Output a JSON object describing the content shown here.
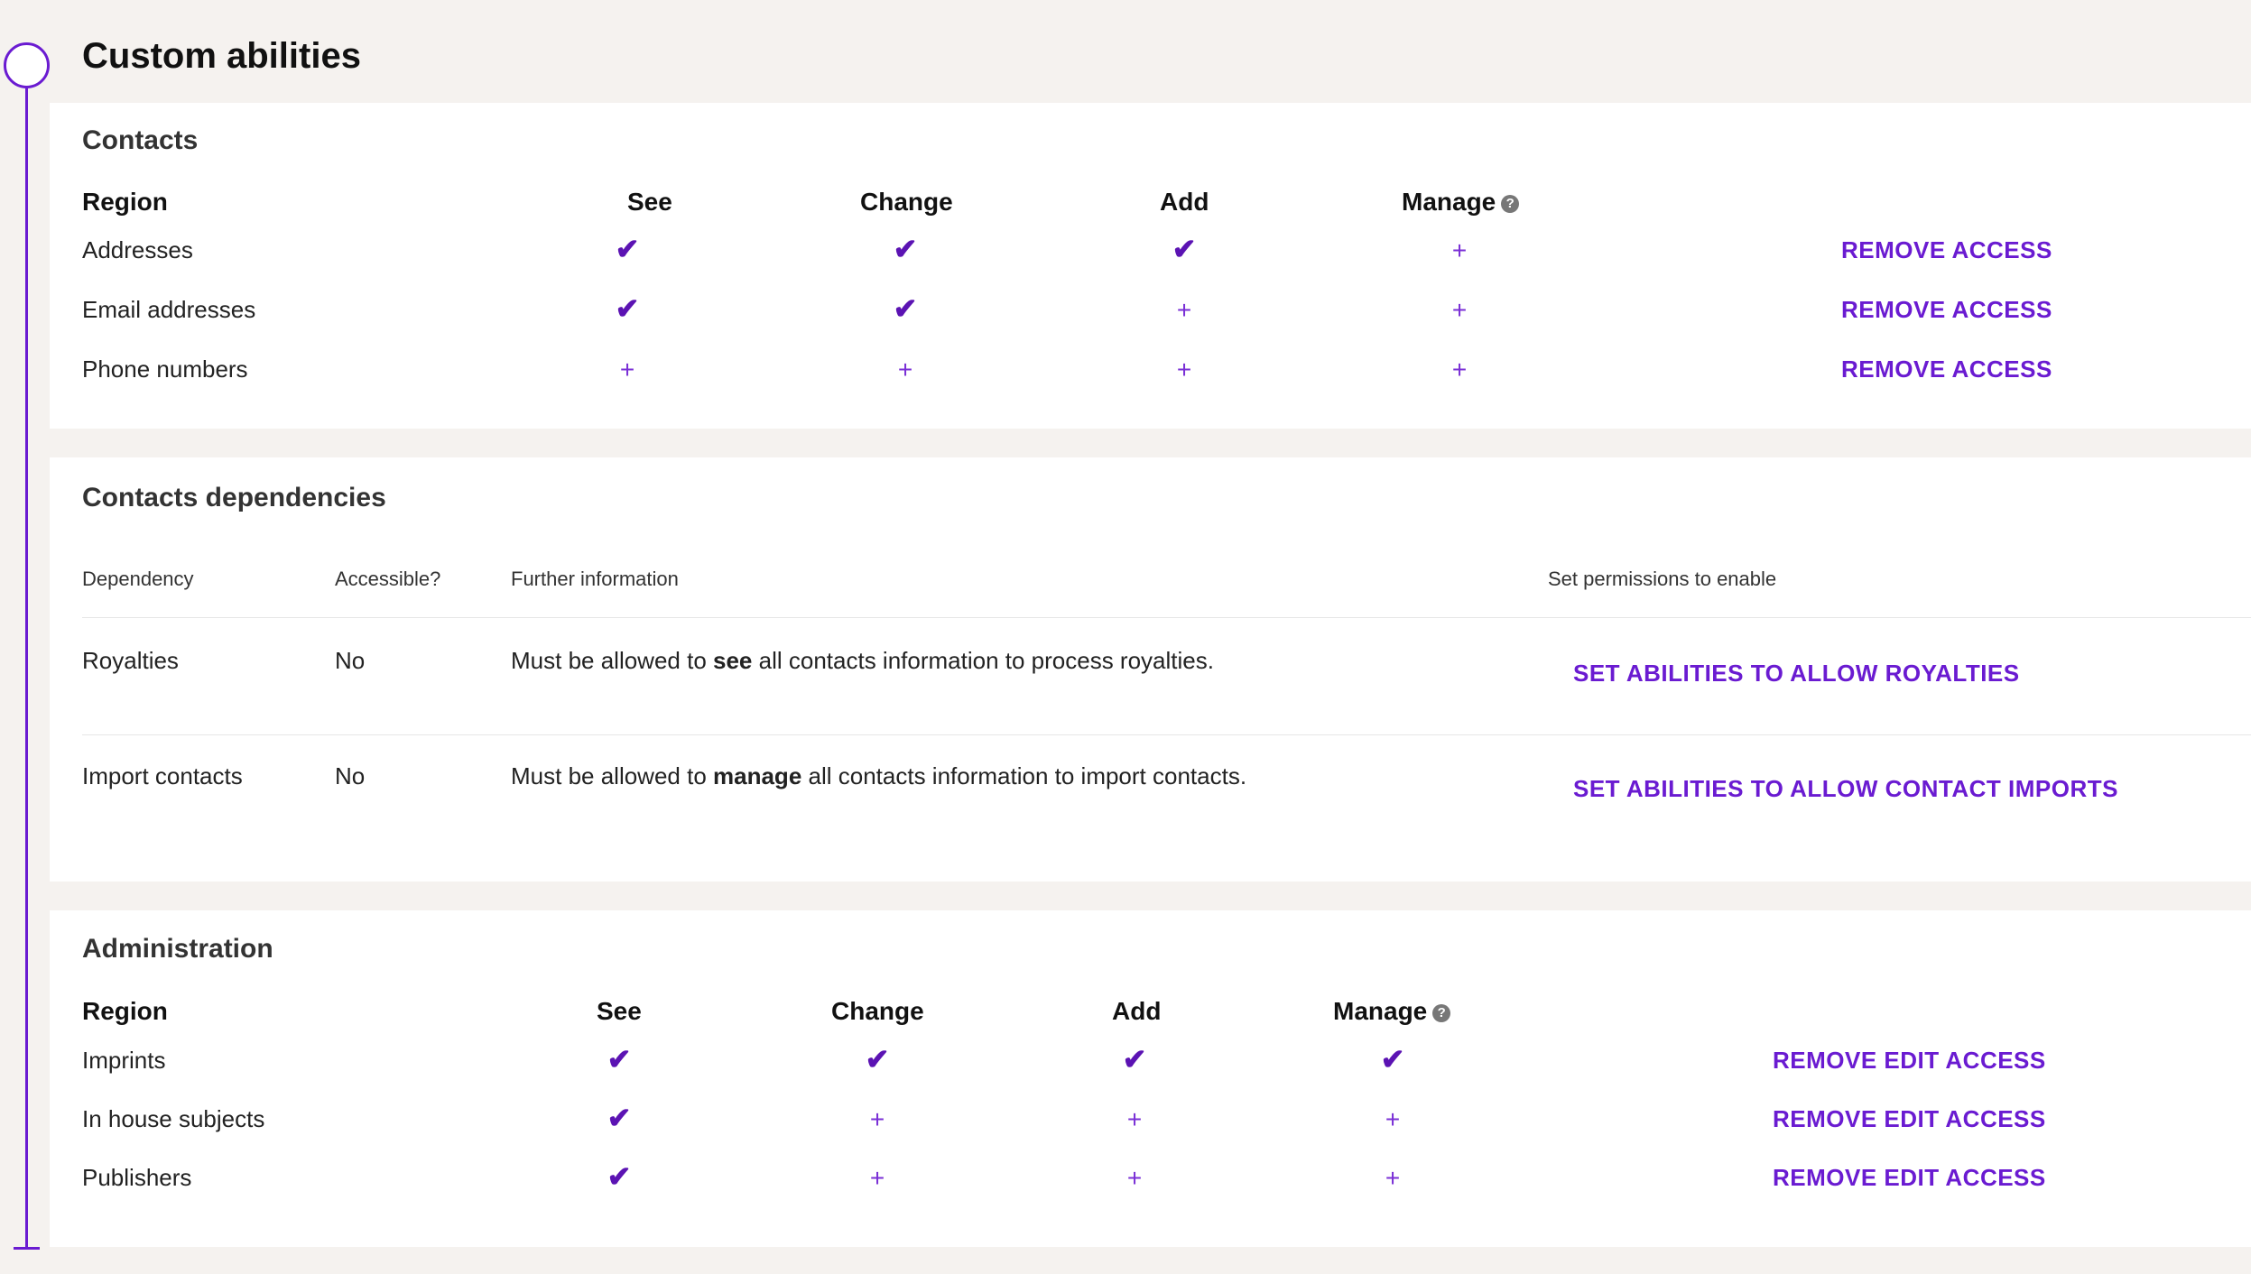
{
  "page": {
    "title": "Custom abilities"
  },
  "colors": {
    "accent": "#6a1bd1",
    "background": "#f5f2ef",
    "card": "#ffffff"
  },
  "contacts": {
    "title": "Contacts",
    "headers": {
      "region": "Region",
      "see": "See",
      "change": "Change",
      "add": "Add",
      "manage": "Manage"
    },
    "rows": [
      {
        "name": "Addresses",
        "see": "check",
        "change": "check",
        "add": "check",
        "manage": "plus",
        "action": "REMOVE ACCESS"
      },
      {
        "name": "Email addresses",
        "see": "check",
        "change": "check",
        "add": "plus",
        "manage": "plus",
        "action": "REMOVE ACCESS"
      },
      {
        "name": "Phone numbers",
        "see": "plus",
        "change": "plus",
        "add": "plus",
        "manage": "plus",
        "action": "REMOVE ACCESS"
      }
    ]
  },
  "dependencies": {
    "title": "Contacts dependencies",
    "headers": {
      "dependency": "Dependency",
      "accessible": "Accessible?",
      "info": "Further information",
      "set": "Set permissions to enable"
    },
    "rows": [
      {
        "name": "Royalties",
        "accessible": "No",
        "info_pre": "Must be allowed to ",
        "info_bold": "see",
        "info_post": " all contacts information to process royalties.",
        "action": "SET ABILITIES TO ALLOW ROYALTIES"
      },
      {
        "name": "Import contacts",
        "accessible": "No",
        "info_pre": "Must be allowed to ",
        "info_bold": "manage",
        "info_post": " all contacts information to import contacts.",
        "action": "SET ABILITIES TO ALLOW CONTACT IMPORTS"
      }
    ]
  },
  "administration": {
    "title": "Administration",
    "headers": {
      "region": "Region",
      "see": "See",
      "change": "Change",
      "add": "Add",
      "manage": "Manage"
    },
    "rows": [
      {
        "name": "Imprints",
        "see": "check",
        "change": "check",
        "add": "check",
        "manage": "check",
        "action": "REMOVE EDIT ACCESS"
      },
      {
        "name": "In house subjects",
        "see": "check",
        "change": "plus",
        "add": "plus",
        "manage": "plus",
        "action": "REMOVE EDIT ACCESS"
      },
      {
        "name": "Publishers",
        "see": "check",
        "change": "plus",
        "add": "plus",
        "manage": "plus",
        "action": "REMOVE EDIT ACCESS"
      }
    ]
  },
  "icons": {
    "check": "✔",
    "plus": "+",
    "help": "?"
  }
}
